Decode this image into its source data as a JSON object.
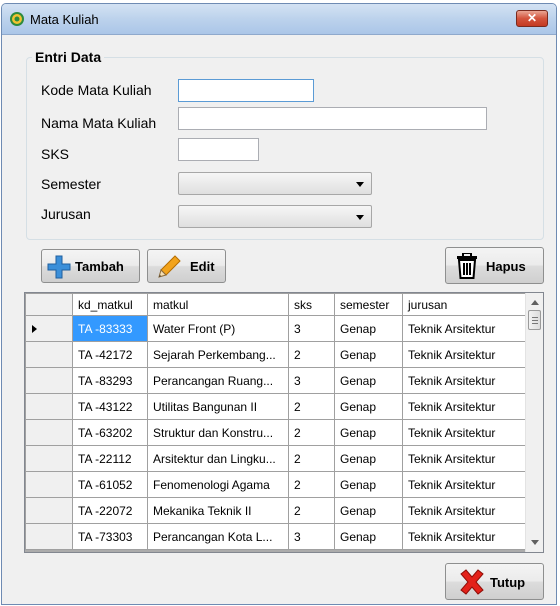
{
  "window": {
    "title": "Mata Kuliah",
    "close_label": "✕"
  },
  "form": {
    "group_title": "Entri Data",
    "kode_label": "Kode Mata Kuliah",
    "kode_value": "",
    "nama_label": "Nama Mata Kuliah",
    "nama_value": "",
    "sks_label": "SKS",
    "sks_value": "",
    "semester_label": "Semester",
    "semester_value": "",
    "jurusan_label": "Jurusan",
    "jurusan_value": ""
  },
  "buttons": {
    "tambah": "Tambah",
    "edit": "Edit",
    "hapus": "Hapus",
    "tutup": "Tutup"
  },
  "grid": {
    "columns": [
      "kd_matkul",
      "matkul",
      "sks",
      "semester",
      "jurusan"
    ],
    "selected_row": 0,
    "rows": [
      [
        "TA -83333",
        "Water Front (P)",
        "3",
        "Genap",
        "Teknik Arsitektur"
      ],
      [
        "TA -42172",
        "Sejarah Perkembang...",
        "2",
        "Genap",
        "Teknik Arsitektur"
      ],
      [
        "TA -83293",
        "Perancangan Ruang...",
        "3",
        "Genap",
        "Teknik Arsitektur"
      ],
      [
        "TA -43122",
        "Utilitas Bangunan II",
        "2",
        "Genap",
        "Teknik Arsitektur"
      ],
      [
        "TA -63202",
        "Struktur dan Konstru...",
        "2",
        "Genap",
        "Teknik Arsitektur"
      ],
      [
        "TA -22112",
        "Arsitektur dan Lingku...",
        "2",
        "Genap",
        "Teknik Arsitektur"
      ],
      [
        "TA -61052",
        "Fenomenologi Agama",
        "2",
        "Genap",
        "Teknik Arsitektur"
      ],
      [
        "TA -22072",
        "Mekanika Teknik II",
        "2",
        "Genap",
        "Teknik Arsitektur"
      ],
      [
        "TA -73303",
        "Perancangan Kota L...",
        "3",
        "Genap",
        "Teknik Arsitektur"
      ]
    ]
  },
  "colors": {
    "title_bar": "#bcd2ec",
    "selection": "#3399ff",
    "close_button": "#c43a22"
  }
}
